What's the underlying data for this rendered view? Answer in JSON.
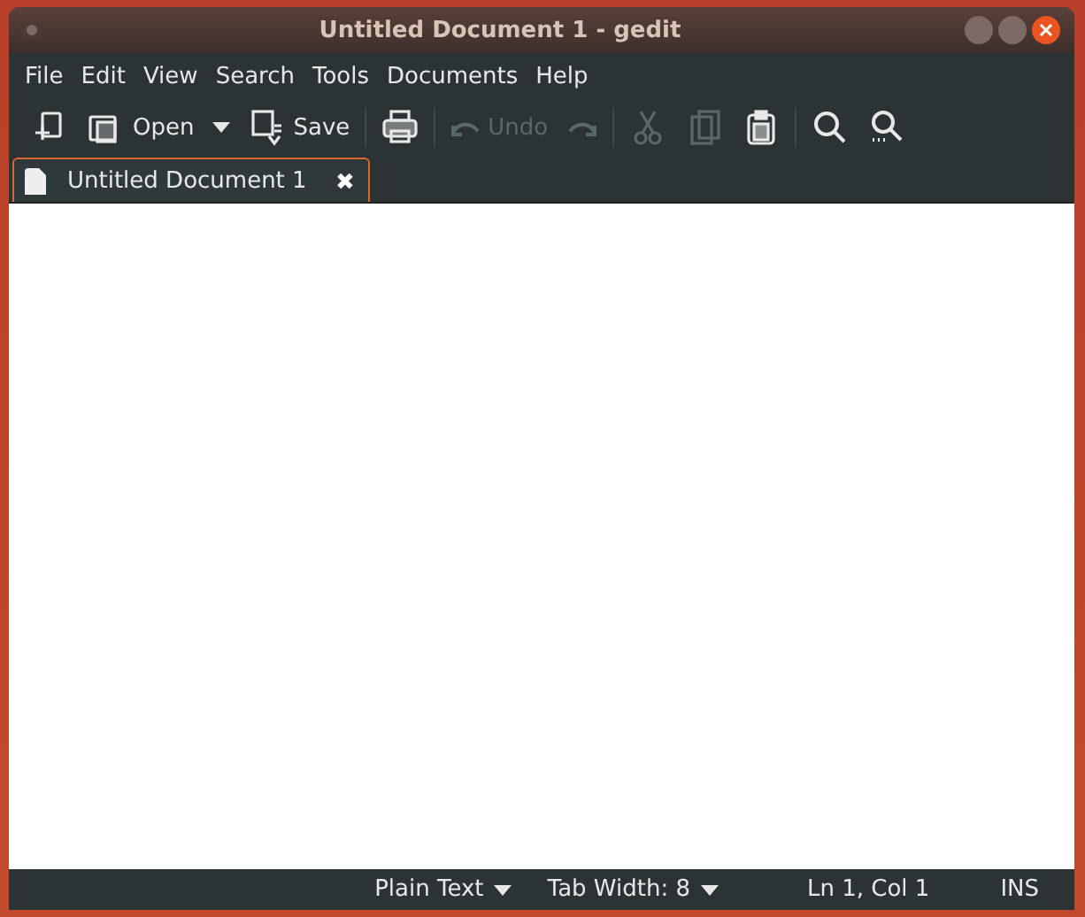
{
  "window": {
    "title": "Untitled Document 1 - gedit"
  },
  "menu": [
    "File",
    "Edit",
    "View",
    "Search",
    "Tools",
    "Documents",
    "Help"
  ],
  "toolbar": [
    [
      {
        "disabled": false
      },
      {
        "label": "Open",
        "disabled": false,
        "dropdown": true
      },
      {
        "label": "Save",
        "disabled": false
      }
    ],
    [
      {
        "disabled": false
      }
    ],
    [
      {
        "label": "Undo",
        "disabled": true
      },
      {
        "disabled": true
      }
    ],
    [
      {
        "disabled": true
      },
      {
        "disabled": true
      },
      {
        "disabled": false
      }
    ],
    [
      {
        "disabled": false
      },
      {
        "disabled": false
      }
    ]
  ],
  "tabs": [
    {
      "label": "Untitled Document 1",
      "selected": true,
      "close": "✖"
    }
  ],
  "status_bar": {
    "language": "Plain Text",
    "tab_width": "Tab Width: 8",
    "position": "Ln 1, Col 1",
    "mode": "INS"
  }
}
